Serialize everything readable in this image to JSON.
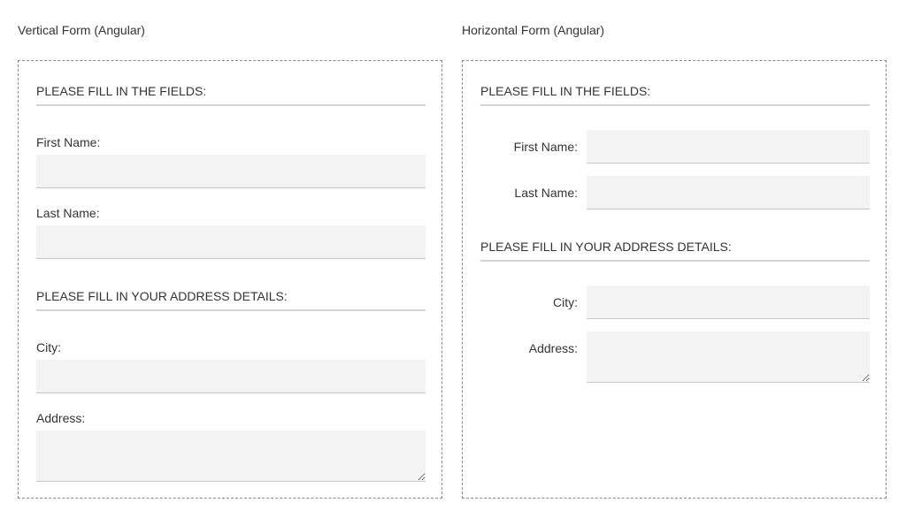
{
  "vertical_form": {
    "title": "Vertical Form (Angular)",
    "section1_header": "PLEASE FILL IN THE FIELDS:",
    "first_name_label": "First Name:",
    "first_name_value": "",
    "last_name_label": "Last Name:",
    "last_name_value": "",
    "section2_header": "PLEASE FILL IN YOUR ADDRESS DETAILS:",
    "city_label": "City:",
    "city_value": "",
    "address_label": "Address:",
    "address_value": ""
  },
  "horizontal_form": {
    "title": "Horizontal Form (Angular)",
    "section1_header": "PLEASE FILL IN THE FIELDS:",
    "first_name_label": "First Name:",
    "first_name_value": "",
    "last_name_label": "Last Name:",
    "last_name_value": "",
    "section2_header": "PLEASE FILL IN YOUR ADDRESS DETAILS:",
    "city_label": "City:",
    "city_value": "",
    "address_label": "Address:",
    "address_value": ""
  }
}
